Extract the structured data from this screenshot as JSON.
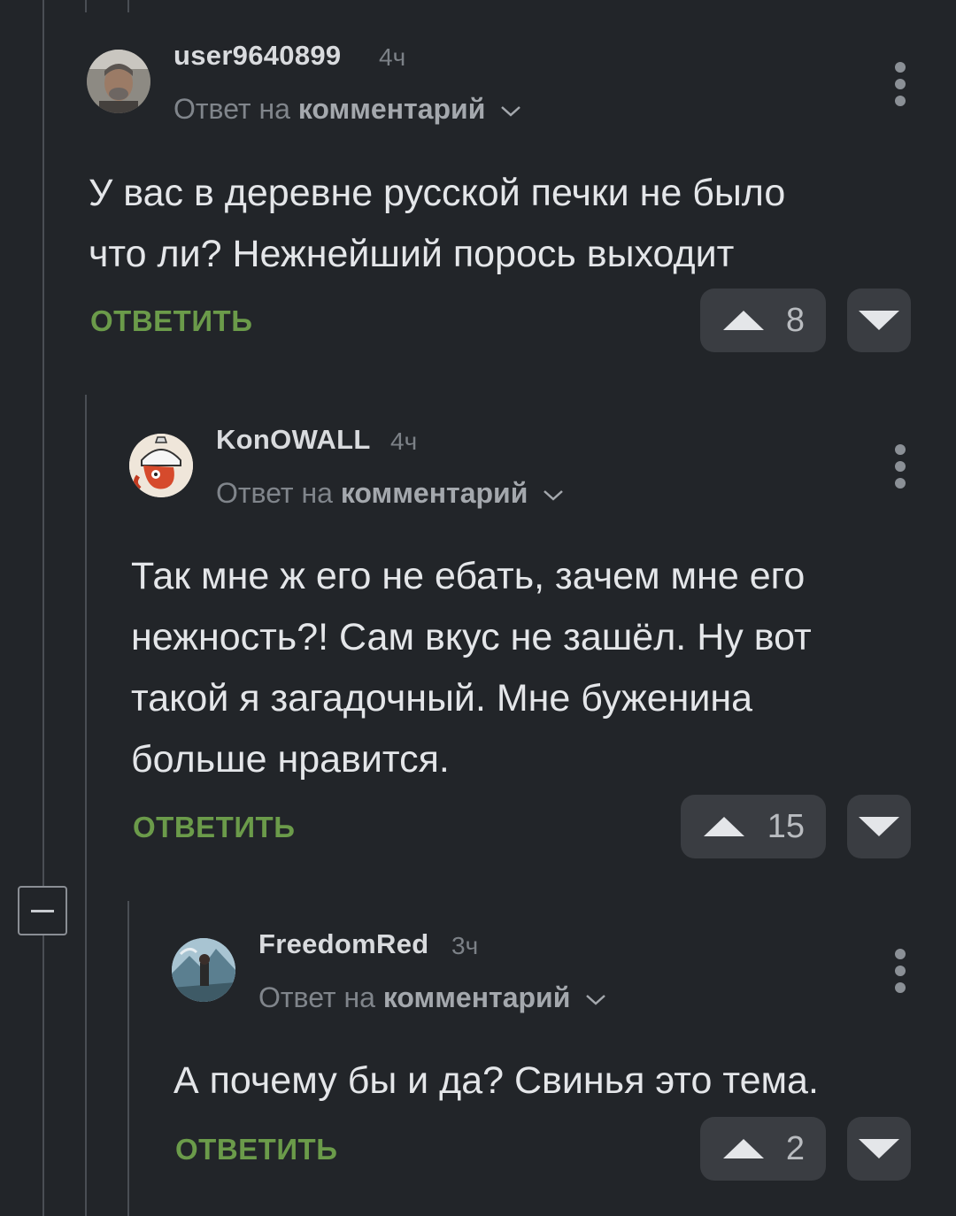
{
  "comments": [
    {
      "username": "user9640899",
      "time": "4ч",
      "reply_prefix": "Ответ на",
      "reply_target": "комментарий",
      "text_lines": [
        "У вас в деревне русской печки не было",
        "что ли? Нежнейший порось выходит"
      ],
      "reply_label": "ОТВЕТИТЬ",
      "votes": "8"
    },
    {
      "username": "KonOWALL",
      "time": "4ч",
      "reply_prefix": "Ответ на",
      "reply_target": "комментарий",
      "text_lines": [
        "Так мне ж его не ебать, зачем мне его",
        "нежность?! Сам вкус не зашёл. Ну вот",
        "такой я загадочный. Мне буженина",
        "больше нравится."
      ],
      "reply_label": "ОТВЕТИТЬ",
      "votes": "15"
    },
    {
      "username": "FreedomRed",
      "time": "3ч",
      "reply_prefix": "Ответ на",
      "reply_target": "комментарий",
      "text_lines": [
        "А почему бы и да? Свинья это тема."
      ],
      "reply_label": "ОТВЕТИТЬ",
      "votes": "2"
    }
  ],
  "icons": {
    "upvote": "triangle-up-icon",
    "downvote": "triangle-down-icon",
    "menu": "kebab-menu-icon",
    "collapse": "minus-icon",
    "chevron": "chevron-down-icon"
  },
  "colors": {
    "background": "#222529",
    "reply_button": "#6b9b4a",
    "vote_button": "#3a3d42"
  }
}
